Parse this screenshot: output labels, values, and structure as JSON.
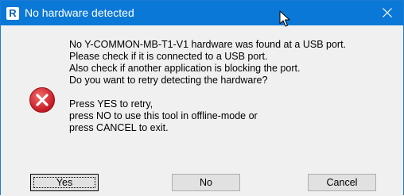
{
  "window": {
    "title": "No hardware detected",
    "app_icon_letter": "R"
  },
  "message": {
    "lines": [
      "No Y-COMMON-MB-T1-V1 hardware was found at a USB port.",
      "Please check if it is connected to a USB port.",
      "Also check if another application is blocking the port.",
      "Do you want to retry detecting the hardware?",
      "",
      "Press YES to retry,",
      "press NO to use this tool in offline-mode or",
      "press CANCEL to exit."
    ]
  },
  "buttons": {
    "yes": "Yes",
    "no": "No",
    "cancel": "Cancel"
  },
  "colors": {
    "titlebar": "#0a78d7",
    "error_icon": "#d9232e"
  },
  "icons": {
    "app": "app-icon",
    "close": "close-icon",
    "error": "error-icon",
    "cursor": "mouse-cursor-icon"
  }
}
